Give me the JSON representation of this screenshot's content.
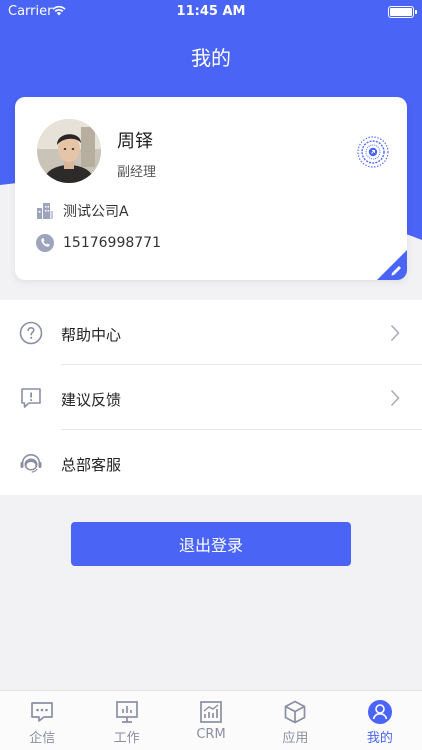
{
  "status_bar": {
    "carrier": "Carrier",
    "time": "11:45 AM"
  },
  "nav": {
    "title": "我的"
  },
  "profile": {
    "name": "周铎",
    "title": "副经理",
    "company": "测试公司A",
    "phone": "15176998771"
  },
  "menu": [
    {
      "label": "帮助中心",
      "icon": "help-icon",
      "has_arrow": true
    },
    {
      "label": "建议反馈",
      "icon": "feedback-icon",
      "has_arrow": true
    },
    {
      "label": "总部客服",
      "icon": "customer-service-icon",
      "has_arrow": false
    }
  ],
  "logout": {
    "label": "退出登录"
  },
  "tabs": [
    {
      "label": "企信",
      "icon": "chat-icon",
      "active": false
    },
    {
      "label": "工作",
      "icon": "work-icon",
      "active": false
    },
    {
      "label": "CRM",
      "icon": "crm-chart-icon",
      "active": false
    },
    {
      "label": "应用",
      "icon": "app-cube-icon",
      "active": false
    },
    {
      "label": "我的",
      "icon": "profile-icon",
      "active": true
    }
  ],
  "colors": {
    "accent": "#4a64f6",
    "background": "#f2f2f4",
    "icon_gray": "#8c8fa3"
  }
}
